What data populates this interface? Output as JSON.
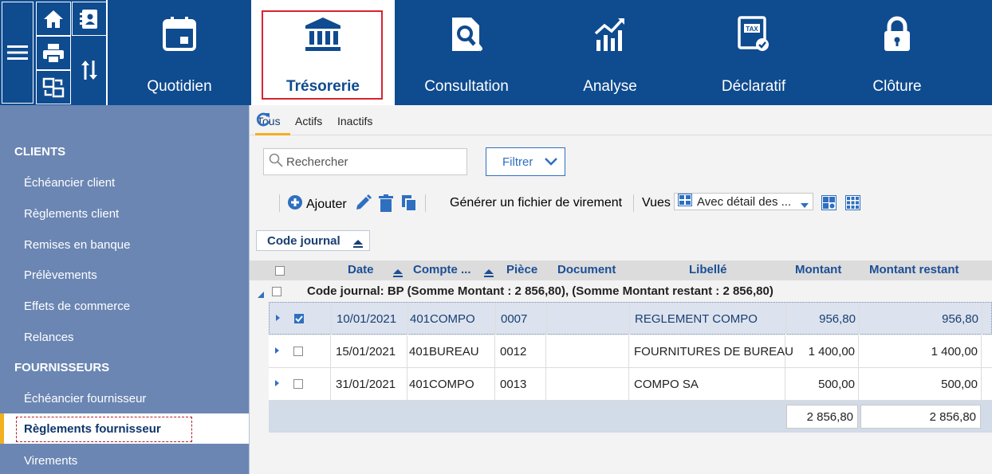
{
  "colors": {
    "brand": "#0f4b8f",
    "sidebar": "#6b86b3",
    "accent": "#f2b01e",
    "highlight": "#d9232e",
    "link": "#1c4f96"
  },
  "quick_icons": [
    "menu-icon",
    "home-icon",
    "contacts-icon",
    "print-icon",
    "transfer-icon",
    "sort-arrows-icon"
  ],
  "nav_tabs": [
    {
      "label": "Quotidien",
      "icon": "calendar-icon"
    },
    {
      "label": "Trésorerie",
      "icon": "bank-icon",
      "active": true
    },
    {
      "label": "Consultation",
      "icon": "search-document-icon"
    },
    {
      "label": "Analyse",
      "icon": "chart-icon"
    },
    {
      "label": "Déclaratif",
      "icon": "tax-icon"
    },
    {
      "label": "Clôture",
      "icon": "lock-icon"
    }
  ],
  "sidebar": {
    "clients_heading": "CLIENTS",
    "clients_items": [
      "Échéancier client",
      "Règlements client",
      "Remises en banque",
      "Prélèvements",
      "Effets de commerce",
      "Relances"
    ],
    "suppliers_heading": "FOURNISSEURS",
    "suppliers_items": [
      "Échéancier fournisseur",
      "Règlements fournisseur",
      "Virements"
    ],
    "active_item": "Règlements fournisseur"
  },
  "subtabs": [
    "Tous",
    "Actifs",
    "Inactifs"
  ],
  "search": {
    "placeholder": "Rechercher"
  },
  "filter": {
    "label": "Filtrer"
  },
  "toolbar": {
    "add_label": "Ajouter",
    "generate_label": "Générer un fichier de virement",
    "views_label": "Vues",
    "views_selected": "Avec détail des ..."
  },
  "group_chip": "Code journal",
  "grid": {
    "columns": [
      "Date",
      "Compte ...",
      "Pièce",
      "Document",
      "Libellé",
      "Montant",
      "Montant restant"
    ],
    "group_label": "Code journal: BP (Somme Montant : 2 856,80), (Somme Montant restant : 2 856,80)",
    "rows": [
      {
        "date": "10/01/2021",
        "compte": "401COMPO",
        "piece": "0007",
        "document": "",
        "libelle": "REGLEMENT COMPO",
        "montant": "956,80",
        "restant": "956,80",
        "checked": true
      },
      {
        "date": "15/01/2021",
        "compte": "401BUREAU",
        "piece": "0012",
        "document": "",
        "libelle": "FOURNITURES DE BUREAU",
        "montant": "1 400,00",
        "restant": "1 400,00",
        "checked": false
      },
      {
        "date": "31/01/2021",
        "compte": "401COMPO",
        "piece": "0013",
        "document": "",
        "libelle": "COMPO SA",
        "montant": "500,00",
        "restant": "500,00",
        "checked": false
      }
    ],
    "total_montant": "2 856,80",
    "total_restant": "2 856,80"
  }
}
